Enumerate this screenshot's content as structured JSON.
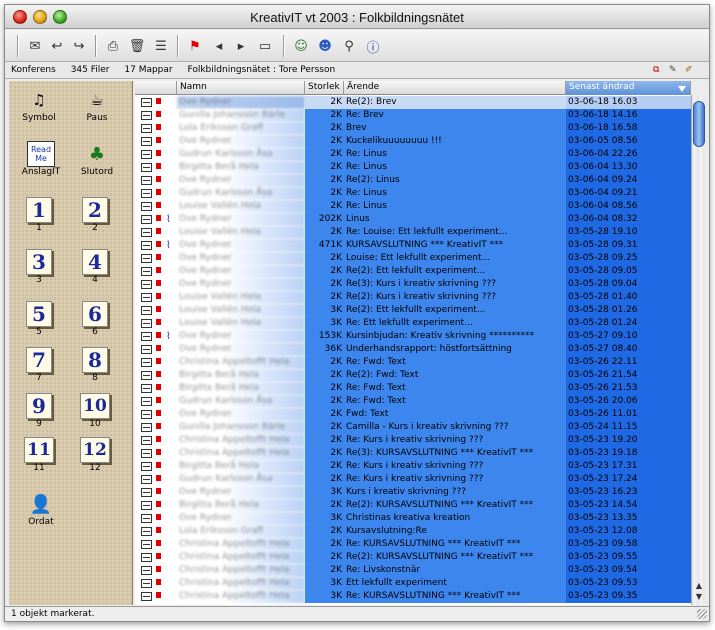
{
  "window": {
    "title": "KreativIT vt 2003 : Folkbildningsnätet"
  },
  "toolbar": {
    "icons": [
      "new-message-icon",
      "reply-icon",
      "forward-icon",
      "print-icon",
      "trash-icon",
      "list-icon",
      "flag-icon",
      "prev-icon",
      "next-icon",
      "folder-icon",
      "people-icon",
      "users-icon",
      "search-icon",
      "info-icon"
    ]
  },
  "infobar": {
    "conference": "Konferens",
    "files": "345 Filer",
    "folders": "17 Mappar",
    "path": "Folkbildningsnätet : Tore Persson"
  },
  "sidebar": {
    "items": [
      {
        "label": "Symbol",
        "icon": "music-notes-icon"
      },
      {
        "label": "Paus",
        "icon": "coffee-cup-icon"
      },
      {
        "label": "AnslagIT",
        "icon": "read-me-icon"
      },
      {
        "label": "Slutord",
        "icon": "tree-icon"
      }
    ],
    "numbers": [
      {
        "glyph": "1",
        "label": "1"
      },
      {
        "glyph": "2",
        "label": "2"
      },
      {
        "glyph": "3",
        "label": "3"
      },
      {
        "glyph": "4",
        "label": "4"
      },
      {
        "glyph": "5",
        "label": "5"
      },
      {
        "glyph": "6",
        "label": "6"
      },
      {
        "glyph": "7",
        "label": "7"
      },
      {
        "glyph": "8",
        "label": "8"
      },
      {
        "glyph": "9",
        "label": "9"
      },
      {
        "glyph": "10",
        "label": "10"
      },
      {
        "glyph": "11",
        "label": "11"
      },
      {
        "glyph": "12",
        "label": "12"
      }
    ],
    "ordat": {
      "label": "Ordat",
      "icon": "person-icon"
    }
  },
  "columns": {
    "name": "Namn",
    "size": "Storlek",
    "subject": "Ärende",
    "modified": "Senast ändrad"
  },
  "messages": [
    {
      "name": "Ove Rydner",
      "size": "2K",
      "subject": "Re(2): Brev",
      "date": "03-06-18 16.03",
      "selected": true,
      "attach": false
    },
    {
      "name": "Gunilla Johansson Bärle",
      "size": "2K",
      "subject": "Re: Brev",
      "date": "03-06-18 14.16",
      "attach": false
    },
    {
      "name": "Lola Eriksson Graff",
      "size": "2K",
      "subject": "Brev",
      "date": "03-06-18 16.58",
      "attach": false
    },
    {
      "name": "Ove Rydner",
      "size": "2K",
      "subject": "Kuckelikuuuuuuuu !!!",
      "date": "03-06-05 08.56",
      "attach": false
    },
    {
      "name": "Gudrun Karlsson Åsa",
      "size": "2K",
      "subject": "Re: Linus",
      "date": "03-06-04 22.26",
      "attach": false
    },
    {
      "name": "Birgitta Berå Hela",
      "size": "2K",
      "subject": "Re: Linus",
      "date": "03-06-04 13.30",
      "attach": false
    },
    {
      "name": "Ove Rydner",
      "size": "2K",
      "subject": "Re(2): Linus",
      "date": "03-06-04 09.24",
      "attach": false
    },
    {
      "name": "Gudrun Karlsson Åsa",
      "size": "2K",
      "subject": "Re: Linus",
      "date": "03-06-04 09.21",
      "attach": false
    },
    {
      "name": "Louise Vallén Hela",
      "size": "2K",
      "subject": "Re: Linus",
      "date": "03-06-04 08.56",
      "attach": false
    },
    {
      "name": "Ove Rydner",
      "size": "202K",
      "subject": "Linus",
      "date": "03-06-04 08.32",
      "attach": true
    },
    {
      "name": "Louise Vallén Hela",
      "size": "2K",
      "subject": "Re: Louise: Ett lekfullt experiment...",
      "date": "03-05-28 19.10",
      "attach": false
    },
    {
      "name": "Ove Rydner",
      "size": "471K",
      "subject": "KURSAVSLUTNING *** KreativIT ***",
      "date": "03-05-28 09.31",
      "attach": true
    },
    {
      "name": "Ove Rydner",
      "size": "2K",
      "subject": "Louise: Ett lekfullt experiment...",
      "date": "03-05-28 09.25",
      "attach": false
    },
    {
      "name": "Ove Rydner",
      "size": "2K",
      "subject": "Re(2): Ett lekfullt experiment...",
      "date": "03-05-28 09.05",
      "attach": false
    },
    {
      "name": "Ove Rydner",
      "size": "2K",
      "subject": "Re(3): Kurs i kreativ skrivning ???",
      "date": "03-05-28 09.04",
      "attach": false
    },
    {
      "name": "Louise Vallén Hela",
      "size": "2K",
      "subject": "Re(2): Kurs i kreativ skrivning ???",
      "date": "03-05-28 01.40",
      "attach": false
    },
    {
      "name": "Louise Vallén Hela",
      "size": "3K",
      "subject": "Re(2): Ett lekfullt experiment...",
      "date": "03-05-28 01.26",
      "attach": false
    },
    {
      "name": "Louise Vallén Hela",
      "size": "3K",
      "subject": "Re: Ett lekfullt experiment...",
      "date": "03-05-28 01.24",
      "attach": false
    },
    {
      "name": "Ove Rydner",
      "size": "153K",
      "subject": "Kursinbjudan: Kreativ skrivning **********",
      "date": "03-05-27 09.10",
      "attach": true
    },
    {
      "name": "Ove Rydner",
      "size": "36K",
      "subject": "Underhandsrapport: höstfortsättning",
      "date": "03-05-27 08.40",
      "attach": false
    },
    {
      "name": "Christina Appeltofft Hela",
      "size": "2K",
      "subject": "Re: Fwd: Text",
      "date": "03-05-26 22.11",
      "attach": false
    },
    {
      "name": "Birgitta Berå Hela",
      "size": "2K",
      "subject": "Re(2): Fwd: Text",
      "date": "03-05-26 21.54",
      "attach": false
    },
    {
      "name": "Birgitta Berå Hela",
      "size": "2K",
      "subject": "Re: Fwd: Text",
      "date": "03-05-26 21.53",
      "attach": false
    },
    {
      "name": "Gudrun Karlsson Åsa",
      "size": "2K",
      "subject": "Re: Fwd: Text",
      "date": "03-05-26 20.06",
      "attach": false
    },
    {
      "name": "Ove Rydner",
      "size": "2K",
      "subject": "Fwd: Text",
      "date": "03-05-26 11.01",
      "attach": false
    },
    {
      "name": "Gunilla Johansson Bärle",
      "size": "2K",
      "subject": "Camilla - Kurs i kreativ skrivning ???",
      "date": "03-05-24 11.15",
      "attach": false
    },
    {
      "name": "Christina Appeltofft Hela",
      "size": "2K",
      "subject": "Re: Kurs i kreativ skrivning ???",
      "date": "03-05-23 19.20",
      "attach": false
    },
    {
      "name": "Christina Appeltofft Hela",
      "size": "2K",
      "subject": "Re(3): KURSAVSLUTNING *** KreativIT ***",
      "date": "03-05-23 19.18",
      "attach": false
    },
    {
      "name": "Birgitta Berå Hela",
      "size": "2K",
      "subject": "Re: Kurs i kreativ skrivning ???",
      "date": "03-05-23 17.31",
      "attach": false
    },
    {
      "name": "Gudrun Karlsson Åsa",
      "size": "2K",
      "subject": "Re: Kurs i kreativ skrivning ???",
      "date": "03-05-23 17.24",
      "attach": false
    },
    {
      "name": "Ove Rydner",
      "size": "3K",
      "subject": "Kurs i kreativ skrivning ???",
      "date": "03-05-23 16.23",
      "attach": false
    },
    {
      "name": "Birgitta Berå Hela",
      "size": "2K",
      "subject": "Re(2): KURSAVSLUTNING *** KreativIT ***",
      "date": "03-05-23 14.54",
      "attach": false
    },
    {
      "name": "Ove Rydner",
      "size": "3K",
      "subject": "Christinas kreativa kreation",
      "date": "03-05-23 13.35",
      "attach": false
    },
    {
      "name": "Lola Eriksson Graff",
      "size": "2K",
      "subject": "Kursavslutning:Re",
      "date": "03-05-23 12.08",
      "attach": false
    },
    {
      "name": "Christina Appeltofft Hela",
      "size": "2K",
      "subject": "Re: KURSAVSLUTNING *** KreativIT ***",
      "date": "03-05-23 09.58",
      "attach": false
    },
    {
      "name": "Christina Appeltofft Hela",
      "size": "2K",
      "subject": "Re(2): KURSAVSLUTNING *** KreativIT ***",
      "date": "03-05-23 09.55",
      "attach": false
    },
    {
      "name": "Christina Appeltofft Hela",
      "size": "2K",
      "subject": "Re: Livskonstnär",
      "date": "03-05-23 09.54",
      "attach": false
    },
    {
      "name": "Christina Appeltofft Hela",
      "size": "3K",
      "subject": "Ett lekfullt experiment",
      "date": "03-05-23 09.53",
      "attach": false
    },
    {
      "name": "Christina Appeltofft Hela",
      "size": "3K",
      "subject": "Re: KURSAVSLUTNING *** KreativIT ***",
      "date": "03-05-23 09.35",
      "attach": false
    }
  ],
  "status": {
    "text": "1 objekt markerat."
  }
}
